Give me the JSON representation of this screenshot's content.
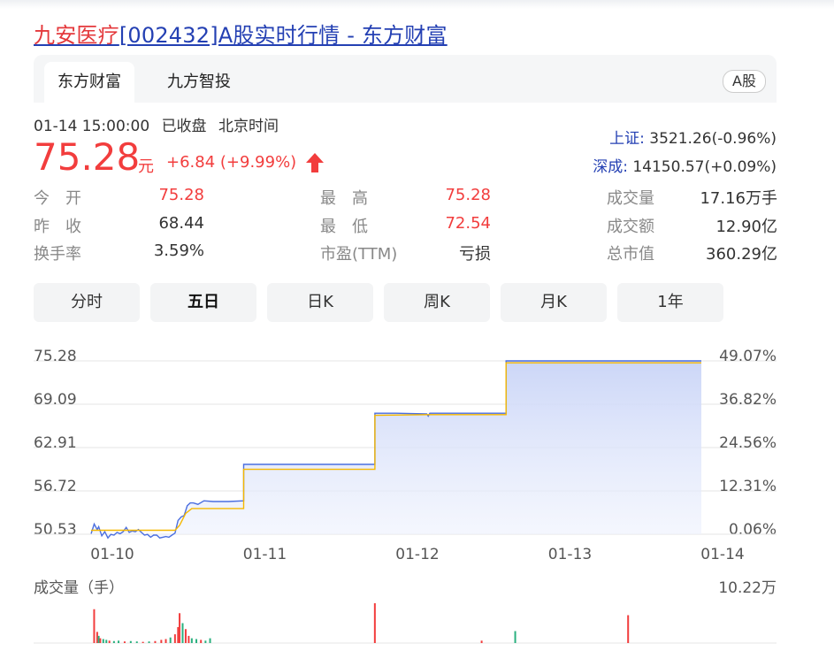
{
  "page": {
    "title_stock": "九安医疗",
    "title_rest": "[002432]A股实时行情 - 东方财富"
  },
  "tabs": [
    "东方财富",
    "九方智投"
  ],
  "market_badge": "A股",
  "quote": {
    "time": "01-14 15:00:00",
    "status": "已收盘",
    "tz": "北京时间",
    "price": "75.28",
    "unit": "元",
    "change": "+6.84 (+9.99%)"
  },
  "indices": [
    {
      "name": "上证:",
      "value": "3521.26(-0.96%)"
    },
    {
      "name": "深成:",
      "value": "14150.57(+0.09%)"
    }
  ],
  "stats": [
    [
      {
        "label": "今　开",
        "value": "75.28",
        "color": "red"
      },
      {
        "label": "最　高",
        "value": "75.28",
        "color": "red"
      },
      {
        "label": "成交量",
        "value": "17.16万手",
        "color": "dark"
      }
    ],
    [
      {
        "label": "昨　收",
        "value": "68.44",
        "color": "dark"
      },
      {
        "label": "最　低",
        "value": "72.54",
        "color": "red"
      },
      {
        "label": "成交额",
        "value": "12.90亿",
        "color": "dark"
      }
    ],
    [
      {
        "label": "换手率",
        "value": "3.59%",
        "color": "dark"
      },
      {
        "label": "市盈(TTM)",
        "value": "亏损",
        "color": "dark"
      },
      {
        "label": "总市值",
        "value": "360.29亿",
        "color": "dark"
      }
    ]
  ],
  "period_tabs": [
    "分时",
    "五日",
    "日K",
    "周K",
    "月K",
    "1年"
  ],
  "active_period": "五日",
  "colors": {
    "up": "#f23d3d",
    "down": "#2ab07f",
    "price_line": "#4a6ee0",
    "avg_line": "#f5b800",
    "link": "#2440b3"
  },
  "chart_data": {
    "type": "line",
    "y_labels_left": [
      "75.28",
      "69.09",
      "62.91",
      "56.72",
      "50.53"
    ],
    "y_labels_right": [
      "49.07%",
      "36.82%",
      "24.56%",
      "12.31%",
      "0.06%"
    ],
    "ylim": [
      50.53,
      75.28
    ],
    "x_labels": [
      "01-10",
      "01-11",
      "01-12",
      "01-13",
      "01-14"
    ],
    "series": [
      {
        "values": [
          [
            0.0,
            50.6
          ],
          [
            0.02,
            52.0
          ],
          [
            0.04,
            51.2
          ],
          [
            0.05,
            51.6
          ],
          [
            0.07,
            50.3
          ],
          [
            0.09,
            50.9
          ],
          [
            0.11,
            50.0
          ],
          [
            0.13,
            50.5
          ],
          [
            0.15,
            50.4
          ],
          [
            0.17,
            50.8
          ],
          [
            0.19,
            50.6
          ],
          [
            0.21,
            50.9
          ],
          [
            0.23,
            51.5
          ],
          [
            0.25,
            50.8
          ],
          [
            0.27,
            51.0
          ],
          [
            0.29,
            50.9
          ],
          [
            0.31,
            51.2
          ],
          [
            0.33,
            50.8
          ],
          [
            0.35,
            50.4
          ],
          [
            0.37,
            50.5
          ],
          [
            0.39,
            50.1
          ],
          [
            0.41,
            50.4
          ],
          [
            0.43,
            50.4
          ],
          [
            0.45,
            50.0
          ],
          [
            0.47,
            50.1
          ],
          [
            0.49,
            50.2
          ],
          [
            0.51,
            50.1
          ],
          [
            0.53,
            50.4
          ],
          [
            0.55,
            50.7
          ],
          [
            0.57,
            52.5
          ],
          [
            0.59,
            53.0
          ],
          [
            0.61,
            53.2
          ],
          [
            0.63,
            54.6
          ],
          [
            0.65,
            55.0
          ],
          [
            0.67,
            55.0
          ],
          [
            0.7,
            54.8
          ],
          [
            0.74,
            55.3
          ],
          [
            0.8,
            55.2
          ],
          [
            0.9,
            55.2
          ],
          [
            1.0,
            55.3
          ],
          [
            1.0,
            60.5
          ],
          [
            1.1,
            60.5
          ],
          [
            1.5,
            60.5
          ],
          [
            1.86,
            60.5
          ],
          [
            1.86,
            67.8
          ],
          [
            2.0,
            67.8
          ],
          [
            2.2,
            67.7
          ],
          [
            2.21,
            67.4
          ],
          [
            2.22,
            67.8
          ],
          [
            2.5,
            67.8
          ],
          [
            2.72,
            67.8
          ],
          [
            2.72,
            75.28
          ],
          [
            3.5,
            75.28
          ],
          [
            4.0,
            75.28
          ]
        ]
      },
      {
        "values": [
          [
            0.0,
            51.1
          ],
          [
            0.1,
            51.1
          ],
          [
            0.3,
            51.1
          ],
          [
            0.55,
            51.1
          ],
          [
            0.58,
            51.8
          ],
          [
            0.62,
            53.5
          ],
          [
            0.66,
            54.2
          ],
          [
            0.75,
            54.2
          ],
          [
            1.0,
            54.2
          ],
          [
            1.0,
            59.8
          ],
          [
            1.5,
            59.8
          ],
          [
            1.86,
            59.8
          ],
          [
            1.86,
            67.5
          ],
          [
            2.2,
            67.6
          ],
          [
            2.5,
            67.6
          ],
          [
            2.72,
            67.6
          ],
          [
            2.72,
            75.0
          ],
          [
            3.5,
            75.0
          ],
          [
            4.0,
            75.0
          ]
        ]
      }
    ],
    "volume_title": "成交量（手）",
    "volume_max_label": "10.22万",
    "volume": [
      [
        0.02,
        0.85,
        "up"
      ],
      [
        0.04,
        0.28,
        "up"
      ],
      [
        0.05,
        0.18,
        "down"
      ],
      [
        0.06,
        0.12,
        "up"
      ],
      [
        0.08,
        0.1,
        "down"
      ],
      [
        0.1,
        0.08,
        "down"
      ],
      [
        0.12,
        0.06,
        "up"
      ],
      [
        0.15,
        0.05,
        "down"
      ],
      [
        0.18,
        0.06,
        "down"
      ],
      [
        0.22,
        0.04,
        "up"
      ],
      [
        0.26,
        0.05,
        "down"
      ],
      [
        0.3,
        0.04,
        "down"
      ],
      [
        0.34,
        0.03,
        "up"
      ],
      [
        0.38,
        0.04,
        "down"
      ],
      [
        0.42,
        0.05,
        "up"
      ],
      [
        0.46,
        0.08,
        "up"
      ],
      [
        0.49,
        0.1,
        "up"
      ],
      [
        0.52,
        0.14,
        "down"
      ],
      [
        0.55,
        0.22,
        "up"
      ],
      [
        0.57,
        0.4,
        "up"
      ],
      [
        0.58,
        0.75,
        "up"
      ],
      [
        0.6,
        0.5,
        "down"
      ],
      [
        0.62,
        0.35,
        "up"
      ],
      [
        0.64,
        0.18,
        "up"
      ],
      [
        0.66,
        0.12,
        "down"
      ],
      [
        0.69,
        0.1,
        "down"
      ],
      [
        0.72,
        0.08,
        "up"
      ],
      [
        0.75,
        0.06,
        "down"
      ],
      [
        0.78,
        0.12,
        "down"
      ],
      [
        1.86,
        1.0,
        "up"
      ],
      [
        2.56,
        0.06,
        "up"
      ],
      [
        2.78,
        0.3,
        "down"
      ],
      [
        3.52,
        0.7,
        "up"
      ]
    ]
  }
}
